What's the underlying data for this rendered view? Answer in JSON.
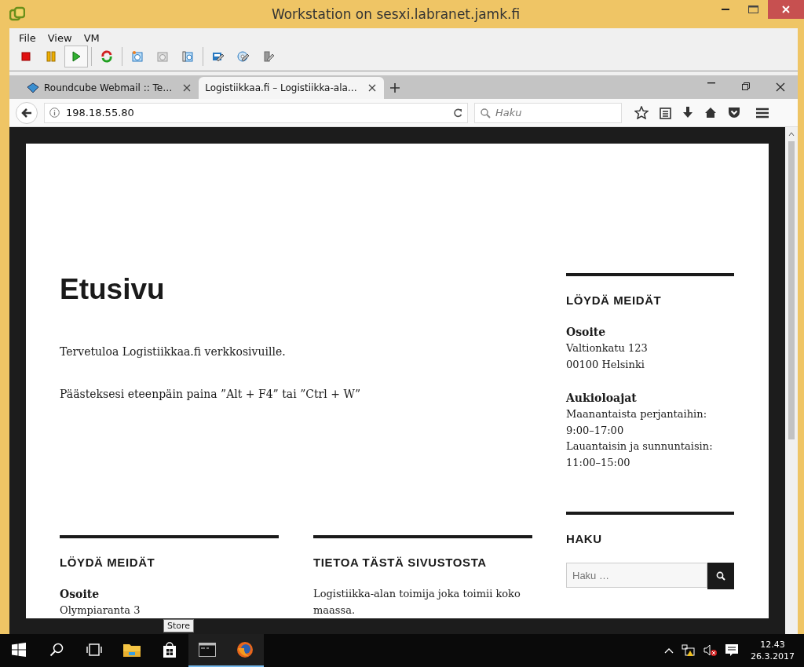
{
  "window": {
    "title": "Workstation on sesxi.labranet.jamk.fi"
  },
  "menu": [
    "File",
    "View",
    "VM"
  ],
  "toolbar": [
    {
      "kind": "stop",
      "pressed": false
    },
    {
      "kind": "pause",
      "pressed": false
    },
    {
      "kind": "play",
      "pressed": true
    },
    {
      "kind": "restart",
      "pressed": false
    },
    {
      "kind": "snapshot",
      "pressed": false
    },
    {
      "kind": "snapshot-disabled",
      "pressed": false
    },
    {
      "kind": "snapshot-manage",
      "pressed": false
    },
    {
      "kind": "edit",
      "pressed": false
    },
    {
      "kind": "tools",
      "pressed": false
    },
    {
      "kind": "usb",
      "pressed": false
    }
  ],
  "browser": {
    "tabs": [
      {
        "label": "Roundcube Webmail :: Te…",
        "selected": false
      },
      {
        "label": "Logistiikkaa.fi – Logistiikka-ala…",
        "selected": true
      }
    ],
    "address": "198.18.55.80",
    "search": {
      "placeholder": "Haku"
    }
  },
  "page": {
    "title": "Etusivu",
    "paragraphs": [
      "Tervetuloa Logistiikkaa.fi verkkosivuille.",
      "Päästeksesi eteenpäin paina ”Alt + F4” tai ”Ctrl + W”"
    ],
    "sidebar": [
      {
        "kind": "info",
        "heading": "LÖYDÄ MEIDÄT",
        "blocks": [
          {
            "label": "Osoite",
            "lines": [
              "Valtionkatu 123",
              "00100 Helsinki"
            ]
          },
          {
            "label": "Aukioloajat",
            "lines": [
              "Maanantaista perjantaihin:",
              "9:00–17:00",
              "Lauantaisin ja sunnuntaisin:",
              "11:00–15:00"
            ]
          }
        ]
      },
      {
        "kind": "search",
        "heading": "HAKU",
        "placeholder": "Haku …"
      }
    ],
    "footer_widgets": [
      {
        "heading": "LÖYDÄ MEIDÄT",
        "label": "Osoite",
        "text": "Olympiaranta 3"
      },
      {
        "heading": "TIETOA TÄSTÄ SIVUSTOSTA",
        "text": "Logistiikka-alan toimija joka toimii koko maassa."
      }
    ]
  },
  "taskbar": {
    "items": [
      {
        "kind": "start",
        "running": false
      },
      {
        "kind": "search",
        "running": false
      },
      {
        "kind": "taskview",
        "running": false
      },
      {
        "kind": "explorer",
        "running": false
      },
      {
        "kind": "store",
        "running": false
      },
      {
        "kind": "terminal",
        "running": true
      },
      {
        "kind": "firefox",
        "running": true
      }
    ],
    "tooltip": "Store",
    "time": "12.43",
    "date": "26.3.2017"
  }
}
